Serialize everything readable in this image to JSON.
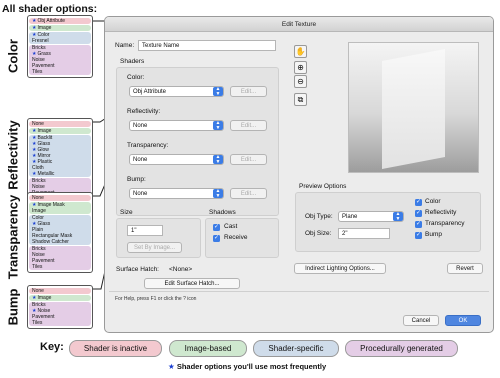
{
  "annotations": {
    "heading": "All shader options:",
    "sections": [
      {
        "label": "Color",
        "groups": [
          {
            "type": "inactive",
            "items": [
              {
                "text": "Obj Attribute",
                "star": true
              }
            ]
          },
          {
            "type": "image",
            "items": [
              {
                "text": "Image",
                "star": true
              }
            ]
          },
          {
            "type": "specific",
            "items": [
              {
                "text": "Color",
                "star": true
              },
              {
                "text": "Fresnel",
                "star": false
              }
            ]
          },
          {
            "type": "procedural",
            "items": [
              {
                "text": "Bricks",
                "star": false
              },
              {
                "text": "Grass",
                "star": true
              },
              {
                "text": "Noise",
                "star": false
              },
              {
                "text": "Pavement",
                "star": false
              },
              {
                "text": "Tiles",
                "star": false
              }
            ]
          }
        ]
      },
      {
        "label": "Reflectivity",
        "groups": [
          {
            "type": "inactive",
            "items": [
              {
                "text": "None",
                "star": false
              }
            ]
          },
          {
            "type": "image",
            "items": [
              {
                "text": "Image",
                "star": true
              }
            ]
          },
          {
            "type": "specific",
            "items": [
              {
                "text": "Backlit",
                "star": true
              },
              {
                "text": "Glass",
                "star": true
              },
              {
                "text": "Glow",
                "star": true
              },
              {
                "text": "Mirror",
                "star": true
              },
              {
                "text": "Plastic",
                "star": true
              },
              {
                "text": "Cloth",
                "star": false
              },
              {
                "text": "Metallic",
                "star": true
              }
            ]
          },
          {
            "type": "procedural",
            "items": [
              {
                "text": "Bricks",
                "star": false
              },
              {
                "text": "Noise",
                "star": false
              },
              {
                "text": "Pavement",
                "star": false
              },
              {
                "text": "Tiles",
                "star": false
              }
            ]
          }
        ]
      },
      {
        "label": "Transparency",
        "groups": [
          {
            "type": "inactive",
            "items": [
              {
                "text": "None",
                "star": false
              }
            ]
          },
          {
            "type": "image",
            "items": [
              {
                "text": "Image Mask",
                "star": true
              },
              {
                "text": "Image",
                "star": false
              }
            ]
          },
          {
            "type": "specific",
            "items": [
              {
                "text": "Color",
                "star": false
              },
              {
                "text": "Glass",
                "star": true
              },
              {
                "text": "Plain",
                "star": false
              },
              {
                "text": "Rectangular Mask",
                "star": false
              },
              {
                "text": "Shadow Catcher",
                "star": false
              }
            ]
          },
          {
            "type": "procedural",
            "items": [
              {
                "text": "Bricks",
                "star": false
              },
              {
                "text": "Noise",
                "star": false
              },
              {
                "text": "Pavement",
                "star": false
              },
              {
                "text": "Tiles",
                "star": false
              }
            ]
          }
        ]
      },
      {
        "label": "Bump",
        "groups": [
          {
            "type": "inactive",
            "items": [
              {
                "text": "None",
                "star": false
              }
            ]
          },
          {
            "type": "image",
            "items": [
              {
                "text": "Image",
                "star": true
              }
            ]
          },
          {
            "type": "procedural",
            "items": [
              {
                "text": "Bricks",
                "star": false
              },
              {
                "text": "Noise",
                "star": true
              },
              {
                "text": "Pavement",
                "star": false
              },
              {
                "text": "Tiles",
                "star": false
              }
            ]
          }
        ]
      }
    ]
  },
  "dialog": {
    "title": "Edit Texture",
    "name_label": "Name:",
    "name_value": "Texture Name",
    "shaders_title": "Shaders",
    "shaders": [
      {
        "label": "Color:",
        "value": "Obj Attribute",
        "edit": "Edit..."
      },
      {
        "label": "Reflectivity:",
        "value": "None",
        "edit": "Edit..."
      },
      {
        "label": "Transparency:",
        "value": "None",
        "edit": "Edit..."
      },
      {
        "label": "Bump:",
        "value": "None",
        "edit": "Edit..."
      }
    ],
    "size_title": "Size",
    "size_value": "1\"",
    "set_by_image": "Set By Image...",
    "shadows_title": "Shadows",
    "shadows": [
      {
        "label": "Cast",
        "checked": true
      },
      {
        "label": "Receive",
        "checked": true
      }
    ],
    "surface_hatch_label": "Surface Hatch:",
    "surface_hatch_value": "<None>",
    "edit_surface_hatch": "Edit Surface Hatch...",
    "preview_options_title": "Preview Options",
    "obj_type_label": "Obj Type:",
    "obj_type_value": "Plane",
    "obj_size_label": "Obj Size:",
    "obj_size_value": "2\"",
    "preview_checks": [
      {
        "label": "Color",
        "checked": true
      },
      {
        "label": "Reflectivity",
        "checked": true
      },
      {
        "label": "Transparency",
        "checked": true
      },
      {
        "label": "Bump",
        "checked": true
      }
    ],
    "indirect_lighting": "Indirect Lighting Options...",
    "revert": "Revert",
    "help_text": "For Help, press F1 or click the ? icon",
    "cancel": "Cancel",
    "ok": "OK",
    "tools": [
      "hand-icon",
      "zoom-in-icon",
      "zoom-out-icon",
      "fit-view-icon"
    ]
  },
  "key": {
    "title": "Key:",
    "items": [
      {
        "label": "Shader is inactive",
        "type": "inactive"
      },
      {
        "label": "Image-based",
        "type": "image"
      },
      {
        "label": "Shader-specific",
        "type": "specific"
      },
      {
        "label": "Procedurally generated",
        "type": "procedural"
      }
    ],
    "footnote": "Shader options you'll use most frequently"
  },
  "colors": {
    "inactive": "#f3c9cf",
    "image": "#cfe8cf",
    "specific": "#cfdcea",
    "procedural": "#e4cde6",
    "star": "#1a3fd1",
    "accent": "#3b7ce6"
  }
}
